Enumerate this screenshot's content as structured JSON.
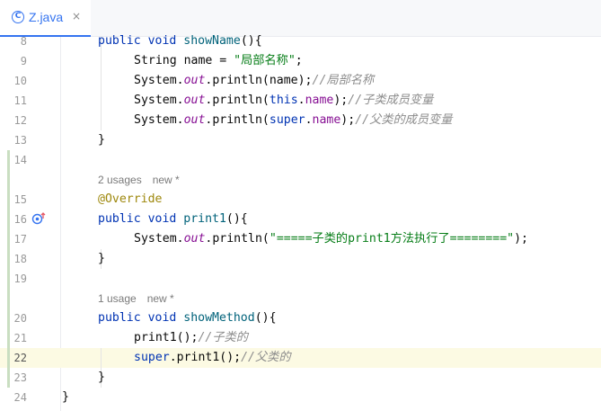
{
  "tab": {
    "title": "Z.java",
    "icon": "class-c-icon",
    "close": "×"
  },
  "lines": [
    {
      "num": "8",
      "tokens": [
        [
          "kw",
          "public "
        ],
        [
          "kw",
          "void "
        ],
        [
          "fn",
          "showName"
        ],
        [
          "",
          "(){"
        ]
      ]
    },
    {
      "num": "9",
      "tokens": [
        [
          "",
          "String name = "
        ],
        [
          "str",
          "\"局部名称\""
        ],
        [
          "",
          ";"
        ]
      ]
    },
    {
      "num": "10",
      "tokens": [
        [
          "",
          "System."
        ],
        [
          "field",
          "out"
        ],
        [
          "",
          ".println(name);"
        ],
        [
          "comment",
          "//局部名称"
        ]
      ]
    },
    {
      "num": "11",
      "tokens": [
        [
          "",
          "System."
        ],
        [
          "field",
          "out"
        ],
        [
          "",
          ".println("
        ],
        [
          "thisref",
          "this"
        ],
        [
          "",
          "."
        ],
        [
          "member",
          "name"
        ],
        [
          "",
          ");"
        ],
        [
          "comment",
          "//子类成员变量"
        ]
      ]
    },
    {
      "num": "12",
      "tokens": [
        [
          "",
          "System."
        ],
        [
          "field",
          "out"
        ],
        [
          "",
          ".println("
        ],
        [
          "thisref",
          "super"
        ],
        [
          "",
          "."
        ],
        [
          "member",
          "name"
        ],
        [
          "",
          ");"
        ],
        [
          "comment",
          "//父类的成员变量"
        ]
      ]
    },
    {
      "num": "13",
      "tokens": [
        [
          "",
          "}"
        ]
      ]
    },
    {
      "num": "14",
      "tokens": []
    },
    {
      "num": "15",
      "tokens": [
        [
          "annot",
          "@Override"
        ]
      ]
    },
    {
      "num": "16",
      "tokens": [
        [
          "kw",
          "public "
        ],
        [
          "kw",
          "void "
        ],
        [
          "fn",
          "print1"
        ],
        [
          "",
          "(){"
        ]
      ]
    },
    {
      "num": "17",
      "tokens": [
        [
          "",
          "System."
        ],
        [
          "field",
          "out"
        ],
        [
          "",
          ".println("
        ],
        [
          "str",
          "\"=====子类的print1方法执行了========\""
        ],
        [
          "",
          ");"
        ]
      ]
    },
    {
      "num": "18",
      "tokens": [
        [
          "",
          "}"
        ]
      ]
    },
    {
      "num": "19",
      "tokens": []
    },
    {
      "num": "20",
      "tokens": [
        [
          "kw",
          "public "
        ],
        [
          "kw",
          "void "
        ],
        [
          "fn",
          "showMethod"
        ],
        [
          "",
          "(){"
        ]
      ]
    },
    {
      "num": "21",
      "tokens": [
        [
          "",
          "print1();"
        ],
        [
          "comment",
          "//子类的"
        ]
      ]
    },
    {
      "num": "22",
      "tokens": [
        [
          "thisref",
          "super"
        ],
        [
          "",
          ".print1();"
        ],
        [
          "comment",
          "//父类的"
        ]
      ]
    },
    {
      "num": "23",
      "tokens": [
        [
          "",
          "}"
        ]
      ]
    },
    {
      "num": "24",
      "tokens": [
        [
          "",
          "}"
        ]
      ]
    }
  ],
  "hints": [
    {
      "usages": "2 usages",
      "new": "new *"
    },
    {
      "usages": "1 usage",
      "new": "new *"
    }
  ],
  "current_line": "22",
  "colors": {
    "keyword": "#0033b3",
    "string": "#067d17",
    "static_field": "#871094",
    "comment": "#8c8c8c",
    "annotation": "#9e880d",
    "current_line": "#fcfae3"
  }
}
